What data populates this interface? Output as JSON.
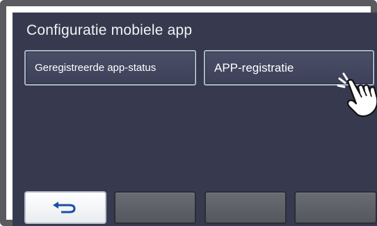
{
  "header": {
    "title": "Configuratie mobiele app"
  },
  "tabs": {
    "status_label": "Geregistreerde app-status",
    "registration_label": "APP-registratie"
  },
  "bottom_bar": {
    "back_icon": "return-arrow-icon",
    "blank_buttons": 3
  },
  "pointer": {
    "icon": "pointing-hand-icon"
  }
}
